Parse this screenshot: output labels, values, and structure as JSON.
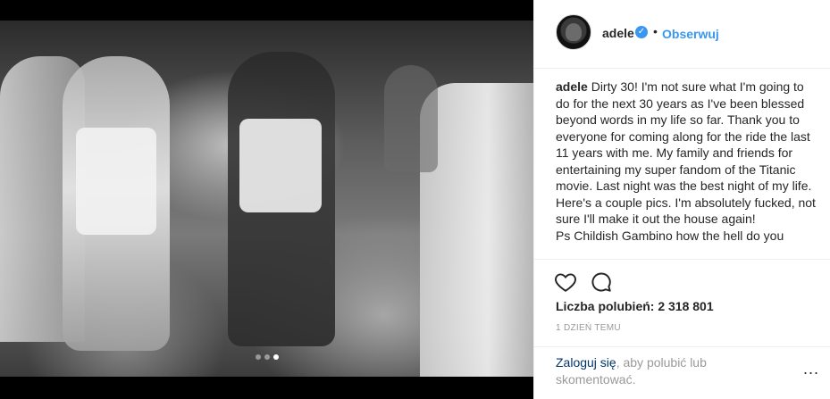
{
  "post": {
    "dots": [
      false,
      false,
      true
    ]
  },
  "header": {
    "username": "adele",
    "verified_glyph": "✓",
    "separator": "•",
    "follow_label": "Obserwuj"
  },
  "caption": {
    "username": "adele",
    "text": "Dirty 30! I'm not sure what I'm going to do for the next 30 years as I've been blessed beyond words in my life so far. Thank you to everyone for coming along for the ride the last 11 years with me. My family and friends for entertaining my super fandom of the Titanic movie. Last night was the best night of my life. Here's a couple pics. I'm absolutely fucked, not sure I'll make it out the house again!",
    "text2": "Ps Childish Gambino how the hell do you"
  },
  "actions": {
    "like_icon": "heart-icon",
    "comment_icon": "comment-icon",
    "likes_label": "Liczba polubień: 2 318 801",
    "time_label": "1 DZIEŃ TEMU"
  },
  "login": {
    "link_label": "Zaloguj się",
    "rest_label": ", aby polubić lub skomentować.",
    "more_label": "..."
  }
}
